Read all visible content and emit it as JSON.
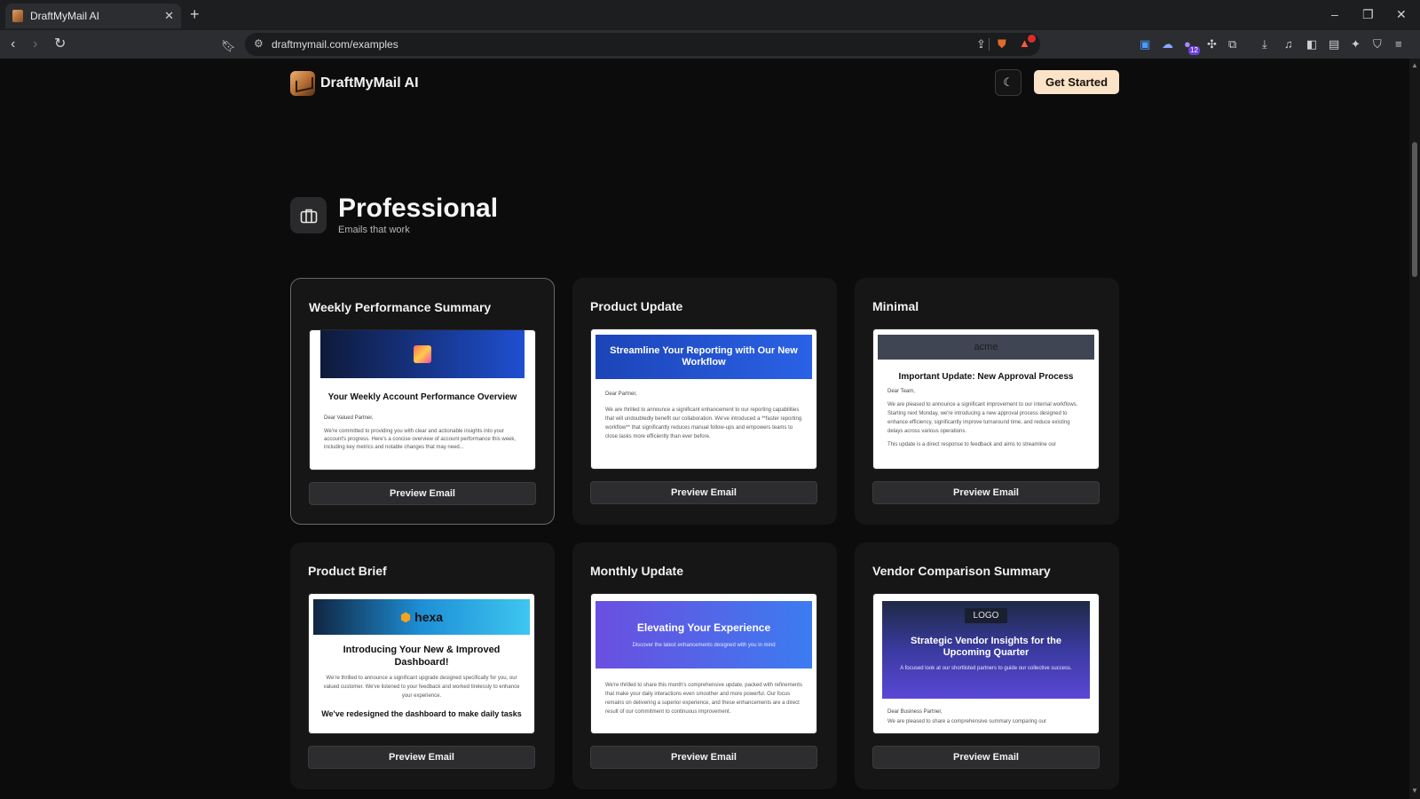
{
  "browser": {
    "tab_title": "DraftMyMail AI",
    "tab_close": "✕",
    "new_tab": "+",
    "url": "draftmymail.com/examples",
    "rewards_count": "",
    "extension_badge": "12",
    "window_controls": {
      "minimize": "–",
      "restore": "❐",
      "close": "✕"
    }
  },
  "header": {
    "brand_name": "DraftMyMail AI",
    "theme_icon": "moon-icon",
    "cta_label": "Get Started"
  },
  "section": {
    "icon": "briefcase-icon",
    "title": "Professional",
    "subtitle": "Emails that work"
  },
  "cards": [
    {
      "title": "Weekly Performance Summary",
      "button": "Preview Email",
      "email": {
        "heading": "Your Weekly Account Performance Overview",
        "greeting": "Dear Valued Partner,",
        "body": "We're committed to providing you with clear and actionable insights into your account's progress. Here's a concise overview of account performance this week, including key metrics and notable changes that may need..."
      }
    },
    {
      "title": "Product Update",
      "button": "Preview Email",
      "email": {
        "heading": "Streamline Your Reporting with Our New Workflow",
        "greeting": "Dear Partner,",
        "body": "We are thrilled to announce a significant enhancement to our reporting capabilities that will undoubtedly benefit our collaboration. We've introduced a **faster reporting workflow** that significantly reduces manual follow-ups and empowers teams to close tasks more efficiently than ever before."
      }
    },
    {
      "title": "Minimal",
      "button": "Preview Email",
      "email": {
        "brand": "acme",
        "heading": "Important Update: New Approval Process",
        "greeting": "Dear Team,",
        "body": "We are pleased to announce a significant improvement to our internal workflows. Starting next Monday, we're introducing a new approval process designed to enhance efficiency, significantly improve turnaround time, and reduce existing delays across various operations.",
        "body2": "This update is a direct response to feedback and aims to streamline our"
      }
    },
    {
      "title": "Product Brief",
      "button": "Preview Email",
      "email": {
        "brand": "hexa",
        "heading": "Introducing Your New & Improved Dashboard!",
        "body": "We're thrilled to announce a significant upgrade designed specifically for you, our valued customer. We've listened to your feedback and worked tirelessly to enhance your experience.",
        "subheading": "We've redesigned the dashboard to make daily tasks"
      }
    },
    {
      "title": "Monthly Update",
      "button": "Preview Email",
      "email": {
        "heading": "Elevating Your Experience",
        "tagline": "Discover the latest enhancements designed with you in mind",
        "body": "We're thrilled to share this month's comprehensive update, packed with refinements that make your daily interactions even smoother and more powerful. Our focus remains on delivering a superior experience, and these enhancements are a direct result of our commitment to continuous improvement."
      }
    },
    {
      "title": "Vendor Comparison Summary",
      "button": "Preview Email",
      "email": {
        "logo": "LOGO",
        "heading": "Strategic Vendor Insights for the Upcoming Quarter",
        "tagline": "A focused look at our shortlisted partners to guide our collective success.",
        "greeting": "Dear Business Partner,",
        "body": "We are pleased to share a comprehensive summary comparing our"
      }
    }
  ],
  "colors": {
    "accent": "#fbe3c8",
    "background": "#0c0c0d",
    "card": "#161617"
  }
}
